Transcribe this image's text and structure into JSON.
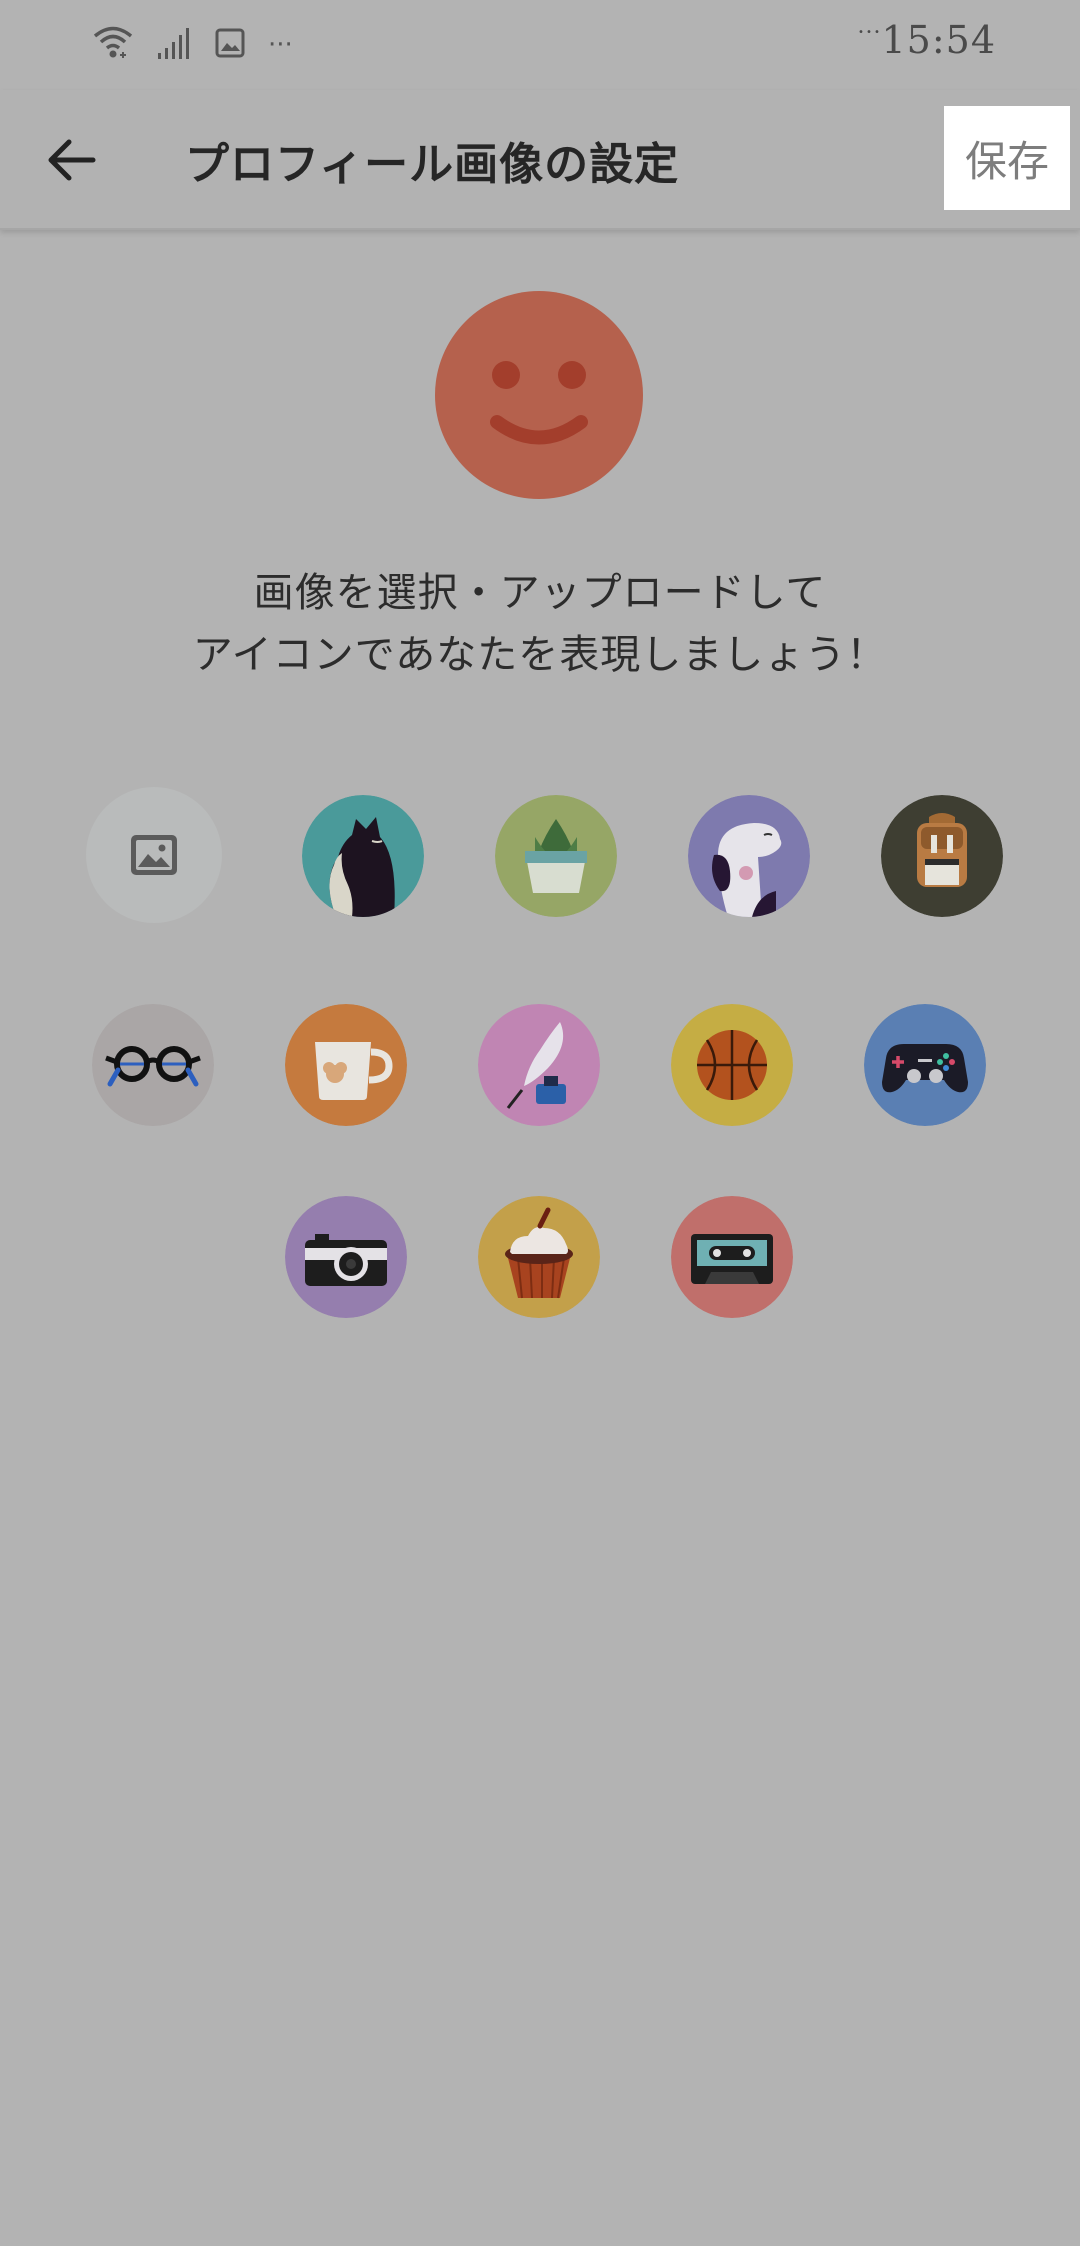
{
  "status_bar": {
    "time": "15:54",
    "more_indicator": "···",
    "icons": [
      "wifi-icon",
      "signal-icon",
      "gallery-notification-icon"
    ]
  },
  "app_bar": {
    "title": "プロフィール画像の設定",
    "save_label": "保存",
    "back_icon": "back-arrow-icon"
  },
  "instruction": {
    "line1": "画像を選択・アップロードして",
    "line2": "アイコンであなたを表現しましょう！"
  },
  "avatar_options": [
    {
      "name": "image-upload-option",
      "icon": "image-icon",
      "color": "#b9bbbb"
    },
    {
      "name": "cat-avatar",
      "icon": "cat-icon",
      "color": "#4a9a9a"
    },
    {
      "name": "plant-avatar",
      "icon": "plant-icon",
      "color": "#96a666"
    },
    {
      "name": "dog-avatar",
      "icon": "dog-icon",
      "color": "#7e7aae"
    },
    {
      "name": "backpack-avatar",
      "icon": "backpack-icon",
      "color": "#3e3e32"
    },
    {
      "name": "glasses-avatar",
      "icon": "glasses-icon",
      "color": "#aaa6a6"
    },
    {
      "name": "cup-avatar",
      "icon": "cup-icon",
      "color": "#c57a3e"
    },
    {
      "name": "quill-avatar",
      "icon": "quill-ink-icon",
      "color": "#c085b3"
    },
    {
      "name": "basketball-avatar",
      "icon": "basketball-icon",
      "color": "#c5ad44"
    },
    {
      "name": "gamepad-avatar",
      "icon": "gamepad-icon",
      "color": "#5a7fb3"
    },
    {
      "name": "camera-avatar",
      "icon": "camera-icon",
      "color": "#957eae"
    },
    {
      "name": "cupcake-avatar",
      "icon": "cupcake-icon",
      "color": "#c3a04a"
    },
    {
      "name": "cassette-avatar",
      "icon": "cassette-icon",
      "color": "#c06f6b"
    }
  ],
  "selected_avatar": {
    "icon": "smiley-face-icon",
    "color": "#b5614d"
  },
  "colors": {
    "overlay_background": "#b3b3b3",
    "save_button_bg": "#ffffff",
    "title_text": "#262626"
  }
}
